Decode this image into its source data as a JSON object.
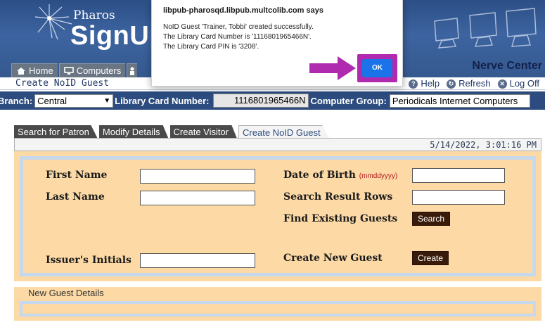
{
  "header": {
    "brand_top": "Pharos",
    "brand_main": "SignUp",
    "module": "Nerve Center",
    "nav": [
      {
        "label": "Home",
        "icon": "home-icon"
      },
      {
        "label": "Computers",
        "icon": "monitor-icon"
      }
    ]
  },
  "subheader": {
    "title": "Create NoID Guest",
    "links": [
      {
        "label": "Help",
        "icon": "help-icon"
      },
      {
        "label": "Refresh",
        "icon": "refresh-icon"
      },
      {
        "label": "Log Off",
        "icon": "logoff-icon"
      }
    ]
  },
  "branchbar": {
    "branch_label": "Branch:",
    "branch_value": "Central",
    "card_label": "Library Card Number:",
    "card_value": "1116801965466N",
    "group_label": "Computer Group:",
    "group_value": "Periodicals Internet Computers"
  },
  "tabs": [
    {
      "label": "Search for Patron",
      "active": false
    },
    {
      "label": "Modify Details",
      "active": false
    },
    {
      "label": "Create Visitor",
      "active": false
    },
    {
      "label": "Create NoID Guest",
      "active": true
    }
  ],
  "datetime": "5/14/2022, 3:01:16 PM",
  "form": {
    "first_name_label": "First Name",
    "last_name_label": "Last Name",
    "issuer_label": "Issuer's Initials",
    "dob_label": "Date of Birth",
    "dob_hint": "(mmddyyyy)",
    "rows_label": "Search Result Rows",
    "find_label": "Find Existing Guests",
    "search_button": "Search",
    "create_label": "Create New Guest",
    "create_button": "Create"
  },
  "new_guest_details": {
    "title": "New Guest Details"
  },
  "dialog": {
    "title": "libpub-pharosqd.libpub.multcolib.com says",
    "lines": [
      "NoID Guest 'Trainer, Tobbi' created successfully.",
      "The Library Card Number is '1116801965466N'.",
      "The Library Card PIN is '3208'."
    ],
    "ok_button": "OK",
    "highlight_color": "#b02ab0",
    "ok_color": "#1a73e8"
  }
}
